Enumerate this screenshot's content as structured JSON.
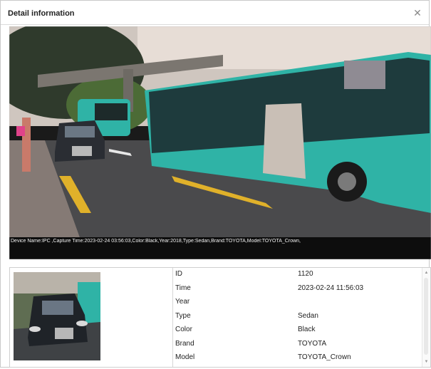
{
  "dialog": {
    "title": "Detail information",
    "close_icon": "close-icon"
  },
  "scene": {
    "overlay_text": "Device Name:IPC ,Capture Time:2023-02-24 03:56:03,Color:Black,Year:2018,Type:Sedan,Brand:TOYOTA,Model:TOYOTA_Crown,"
  },
  "info": {
    "rows": [
      {
        "label": "ID",
        "value": "1120"
      },
      {
        "label": "Time",
        "value": "2023-02-24 11:56:03"
      },
      {
        "label": "Year",
        "value": ""
      },
      {
        "label": "Type",
        "value": "Sedan"
      },
      {
        "label": "Color",
        "value": "Black"
      },
      {
        "label": "Brand",
        "value": "TOYOTA"
      },
      {
        "label": "Model",
        "value": "TOYOTA_Crown"
      }
    ]
  },
  "colors": {
    "bus": "#2fb3a6",
    "road": "#4a4a4c",
    "lane_yellow": "#e0b12a"
  }
}
